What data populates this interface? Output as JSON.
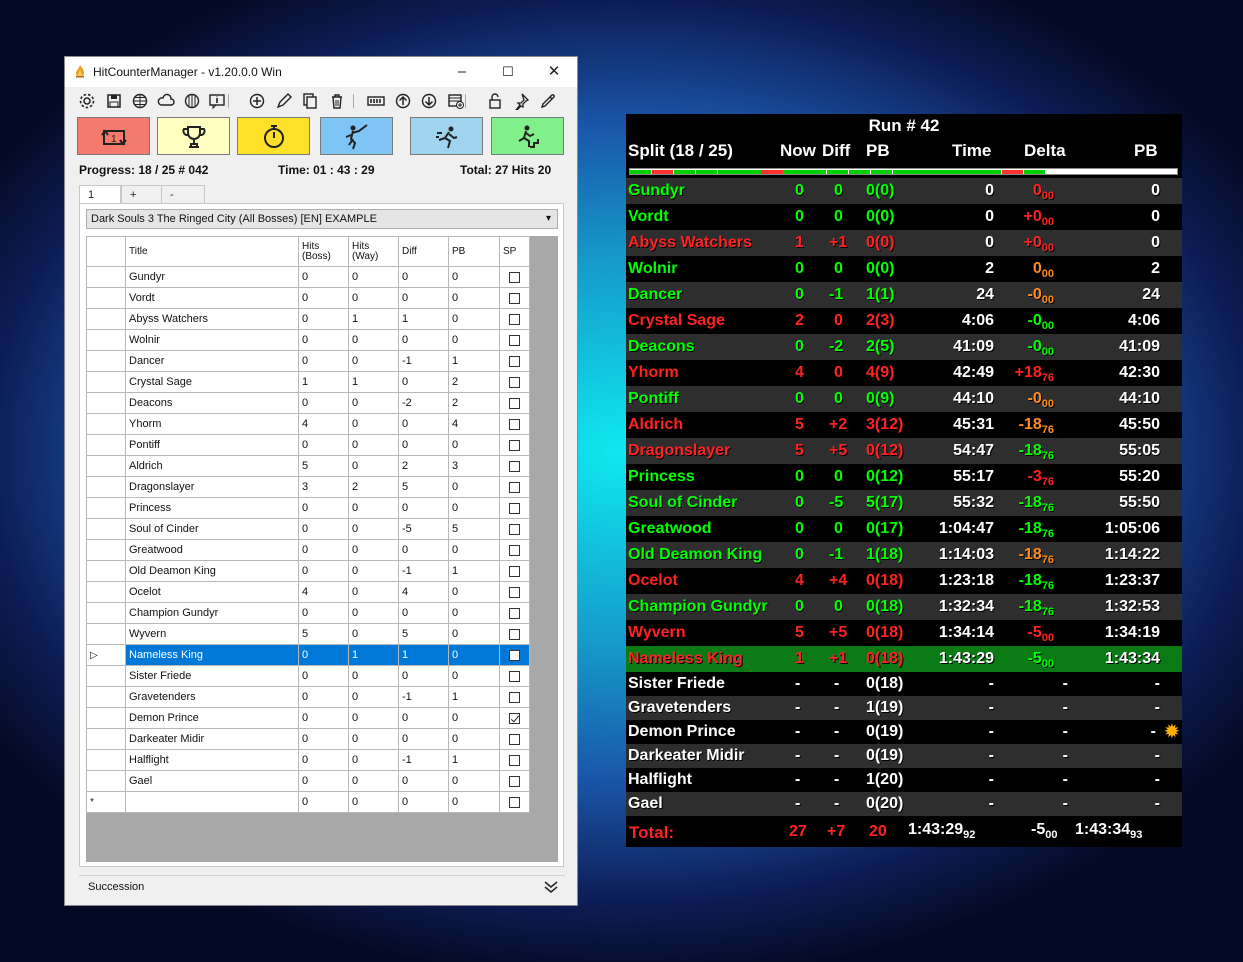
{
  "window": {
    "title": "HitCounterManager - v1.20.0.0 Win",
    "minimize": "–",
    "maximize": "☐",
    "close": "✕"
  },
  "toolbar_icons": [
    "settings-icon",
    "save-icon",
    "globe-icon",
    "cloud-icon",
    "keyboard-icon",
    "info-icon",
    "add-icon",
    "edit-icon",
    "copy-icon",
    "delete-icon",
    "counter-icon",
    "arrow-up-icon",
    "arrow-down-icon",
    "insert-icon",
    "lock-icon",
    "pin-icon",
    "eyedropper-icon"
  ],
  "big_buttons": [
    {
      "name": "reset-button",
      "color": "#f57a6e"
    },
    {
      "name": "pb-button",
      "color": "#ffffc0"
    },
    {
      "name": "timer-button",
      "color": "#ffe028"
    },
    {
      "name": "hit-boss-button",
      "color": "#7ec4f4"
    },
    {
      "name": "hit-way-button",
      "color": "#a0d4ee"
    },
    {
      "name": "split-button",
      "color": "#82f08a"
    }
  ],
  "stats": {
    "progress": "Progress:  18 / 25  # 042",
    "time": "Time: 01 : 43 : 29",
    "total": "Total: 27 Hits   20"
  },
  "tabs": [
    "1",
    "+",
    "-"
  ],
  "profile": "Dark Souls 3 The Ringed City (All Bosses) [EN] EXAMPLE",
  "grid": {
    "headers": [
      "Title",
      "Hits\n(Boss)",
      "Hits\n(Way)",
      "Diff",
      "PB",
      "SP"
    ],
    "rows": [
      [
        "Gundyr",
        "0",
        "0",
        "0",
        "0",
        false
      ],
      [
        "Vordt",
        "0",
        "0",
        "0",
        "0",
        false
      ],
      [
        "Abyss Watchers",
        "0",
        "1",
        "1",
        "0",
        false
      ],
      [
        "Wolnir",
        "0",
        "0",
        "0",
        "0",
        false
      ],
      [
        "Dancer",
        "0",
        "0",
        "-1",
        "1",
        false
      ],
      [
        "Crystal Sage",
        "1",
        "1",
        "0",
        "2",
        false
      ],
      [
        "Deacons",
        "0",
        "0",
        "-2",
        "2",
        false
      ],
      [
        "Yhorm",
        "4",
        "0",
        "0",
        "4",
        false
      ],
      [
        "Pontiff",
        "0",
        "0",
        "0",
        "0",
        false
      ],
      [
        "Aldrich",
        "5",
        "0",
        "2",
        "3",
        false
      ],
      [
        "Dragonslayer",
        "3",
        "2",
        "5",
        "0",
        false
      ],
      [
        "Princess",
        "0",
        "0",
        "0",
        "0",
        false
      ],
      [
        "Soul of Cinder",
        "0",
        "0",
        "-5",
        "5",
        false
      ],
      [
        "Greatwood",
        "0",
        "0",
        "0",
        "0",
        false
      ],
      [
        "Old Deamon King",
        "0",
        "0",
        "-1",
        "1",
        false
      ],
      [
        "Ocelot",
        "4",
        "0",
        "4",
        "0",
        false
      ],
      [
        "Champion Gundyr",
        "0",
        "0",
        "0",
        "0",
        false
      ],
      [
        "Wyvern",
        "5",
        "0",
        "5",
        "0",
        false
      ],
      [
        "Nameless King",
        "0",
        "1",
        "1",
        "0",
        false
      ],
      [
        "Sister Friede",
        "0",
        "0",
        "0",
        "0",
        false
      ],
      [
        "Gravetenders",
        "0",
        "0",
        "-1",
        "1",
        false
      ],
      [
        "Demon Prince",
        "0",
        "0",
        "0",
        "0",
        true
      ],
      [
        "Darkeater Midir",
        "0",
        "0",
        "0",
        "0",
        false
      ],
      [
        "Halflight",
        "0",
        "0",
        "-1",
        "1",
        false
      ],
      [
        "Gael",
        "0",
        "0",
        "0",
        "0",
        false
      ],
      [
        "",
        "0",
        "0",
        "0",
        "0",
        false
      ]
    ],
    "selected_row": 18,
    "new_row_marker": "*",
    "current_marker": "▷"
  },
  "succession_label": "Succession",
  "overlay": {
    "run": "Run # 42",
    "headers": {
      "split": "Split (18 / 25)",
      "now": "Now",
      "diff": "Diff",
      "pb": "PB",
      "time": "Time",
      "delta": "Delta",
      "pb2": "PB"
    },
    "rows": [
      {
        "name": "Gundyr",
        "c": "g",
        "now": "0",
        "diff": "0",
        "pb": "0(0)",
        "time": "0",
        "delta": "0",
        "dsub": "00",
        "dc": "r",
        "pbt": "0"
      },
      {
        "name": "Vordt",
        "c": "g",
        "now": "0",
        "diff": "0",
        "pb": "0(0)",
        "time": "0",
        "delta": "+0",
        "dsub": "00",
        "dc": "r",
        "pbt": "0"
      },
      {
        "name": "Abyss Watchers",
        "c": "r",
        "now": "1",
        "diff": "+1",
        "pb": "0(0)",
        "time": "0",
        "delta": "+0",
        "dsub": "00",
        "dc": "r",
        "pbt": "0"
      },
      {
        "name": "Wolnir",
        "c": "g",
        "now": "0",
        "diff": "0",
        "pb": "0(0)",
        "time": "2",
        "delta": "0",
        "dsub": "00",
        "dc": "o",
        "pbt": "2"
      },
      {
        "name": "Dancer",
        "c": "g",
        "now": "0",
        "diff": "-1",
        "pb": "1(1)",
        "time": "24",
        "delta": "-0",
        "dsub": "00",
        "dc": "o",
        "pbt": "24"
      },
      {
        "name": "Crystal Sage",
        "c": "r",
        "now": "2",
        "diff": "0",
        "pb": "2(3)",
        "time": "4:06",
        "delta": "-0",
        "dsub": "00",
        "dc": "g",
        "pbt": "4:06"
      },
      {
        "name": "Deacons",
        "c": "g",
        "now": "0",
        "diff": "-2",
        "pb": "2(5)",
        "time": "41:09",
        "delta": "-0",
        "dsub": "00",
        "dc": "g",
        "pbt": "41:09"
      },
      {
        "name": "Yhorm",
        "c": "r",
        "now": "4",
        "diff": "0",
        "pb": "4(9)",
        "time": "42:49",
        "delta": "+18",
        "dsub": "76",
        "dc": "r",
        "pbt": "42:30"
      },
      {
        "name": "Pontiff",
        "c": "g",
        "now": "0",
        "diff": "0",
        "pb": "0(9)",
        "time": "44:10",
        "delta": "-0",
        "dsub": "00",
        "dc": "o",
        "pbt": "44:10"
      },
      {
        "name": "Aldrich",
        "c": "r",
        "now": "5",
        "diff": "+2",
        "pb": "3(12)",
        "time": "45:31",
        "delta": "-18",
        "dsub": "76",
        "dc": "o",
        "pbt": "45:50"
      },
      {
        "name": "Dragonslayer",
        "c": "r",
        "now": "5",
        "diff": "+5",
        "pb": "0(12)",
        "time": "54:47",
        "delta": "-18",
        "dsub": "76",
        "dc": "g",
        "pbt": "55:05"
      },
      {
        "name": "Princess",
        "c": "g",
        "now": "0",
        "diff": "0",
        "pb": "0(12)",
        "time": "55:17",
        "delta": "-3",
        "dsub": "76",
        "dc": "r",
        "pbt": "55:20"
      },
      {
        "name": "Soul of Cinder",
        "c": "g",
        "now": "0",
        "diff": "-5",
        "pb": "5(17)",
        "time": "55:32",
        "delta": "-18",
        "dsub": "76",
        "dc": "g",
        "pbt": "55:50"
      },
      {
        "name": "Greatwood",
        "c": "g",
        "now": "0",
        "diff": "0",
        "pb": "0(17)",
        "time": "1:04:47",
        "delta": "-18",
        "dsub": "76",
        "dc": "g",
        "pbt": "1:05:06"
      },
      {
        "name": "Old Deamon King",
        "c": "g",
        "now": "0",
        "diff": "-1",
        "pb": "1(18)",
        "time": "1:14:03",
        "delta": "-18",
        "dsub": "76",
        "dc": "o",
        "pbt": "1:14:22"
      },
      {
        "name": "Ocelot",
        "c": "r",
        "now": "4",
        "diff": "+4",
        "pb": "0(18)",
        "time": "1:23:18",
        "delta": "-18",
        "dsub": "76",
        "dc": "g",
        "pbt": "1:23:37"
      },
      {
        "name": "Champion Gundyr",
        "c": "g",
        "now": "0",
        "diff": "0",
        "pb": "0(18)",
        "time": "1:32:34",
        "delta": "-18",
        "dsub": "76",
        "dc": "g",
        "pbt": "1:32:53"
      },
      {
        "name": "Wyvern",
        "c": "r",
        "now": "5",
        "diff": "+5",
        "pb": "0(18)",
        "time": "1:34:14",
        "delta": "-5",
        "dsub": "00",
        "dc": "r",
        "pbt": "1:34:19"
      },
      {
        "name": "Nameless King",
        "c": "r",
        "now": "1",
        "diff": "+1",
        "pb": "0(18)",
        "time": "1:43:29",
        "delta": "-5",
        "dsub": "00",
        "dc": "g",
        "pbt": "1:43:34",
        "current": true
      },
      {
        "name": "Sister Friede",
        "c": "w",
        "now": "-",
        "diff": "-",
        "pb": "0(18)",
        "time": "-",
        "delta": "-",
        "dsub": "",
        "dc": "w",
        "pbt": "-"
      },
      {
        "name": "Gravetenders",
        "c": "w",
        "now": "-",
        "diff": "-",
        "pb": "1(19)",
        "time": "-",
        "delta": "-",
        "dsub": "",
        "dc": "w",
        "pbt": "-"
      },
      {
        "name": "Demon Prince",
        "c": "w",
        "now": "-",
        "diff": "-",
        "pb": "0(19)",
        "time": "-",
        "delta": "-",
        "dsub": "",
        "dc": "w",
        "pbt": "-",
        "sp": true
      },
      {
        "name": "Darkeater Midir",
        "c": "w",
        "now": "-",
        "diff": "-",
        "pb": "0(19)",
        "time": "-",
        "delta": "-",
        "dsub": "",
        "dc": "w",
        "pbt": "-"
      },
      {
        "name": "Halflight",
        "c": "w",
        "now": "-",
        "diff": "-",
        "pb": "1(20)",
        "time": "-",
        "delta": "-",
        "dsub": "",
        "dc": "w",
        "pbt": "-"
      },
      {
        "name": "Gael",
        "c": "w",
        "now": "-",
        "diff": "-",
        "pb": "0(20)",
        "time": "-",
        "delta": "-",
        "dsub": "",
        "dc": "w",
        "pbt": "-"
      }
    ],
    "total": {
      "label": "Total:",
      "now": "27",
      "diff": "+7",
      "pb": "20",
      "time": "1:43:29",
      "tsub": "92",
      "delta": "-5",
      "dsub": "00",
      "pbt": "1:43:34",
      "psub": "93"
    },
    "progress_bar": [
      "g",
      "r",
      "g",
      "g",
      "g",
      "g",
      "r",
      "g",
      "g",
      "g",
      "g",
      "g",
      "g",
      "g",
      "g",
      "g",
      "g",
      "r",
      "g",
      "w",
      "w",
      "w",
      "w",
      "w",
      "w"
    ],
    "colors": {
      "green": "#00ff00",
      "red": "#ff2222",
      "orange": "#ff8c1a",
      "current_row": "#0a7a14",
      "row_dark": "#2e2e2e",
      "row_black": "#000000"
    }
  }
}
